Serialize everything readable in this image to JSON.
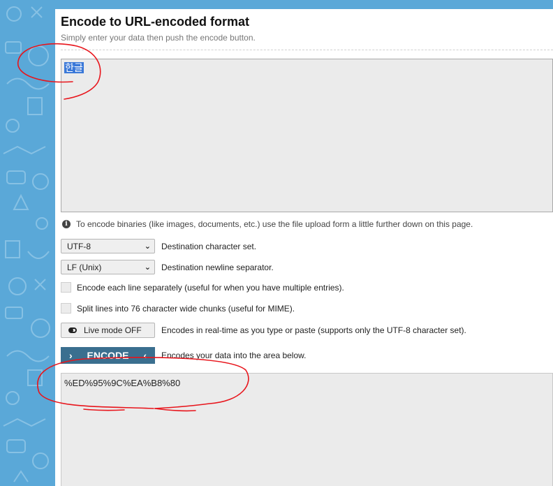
{
  "header": {
    "title": "Encode to URL-encoded format",
    "subtitle": "Simply enter your data then push the encode button."
  },
  "input": {
    "value": "한글"
  },
  "note": {
    "text": "To encode binaries (like images, documents, etc.) use the file upload form a little further down on this page."
  },
  "options": {
    "charset": {
      "value": "UTF-8",
      "label": "Destination character set."
    },
    "newline": {
      "value": "LF (Unix)",
      "label": "Destination newline separator."
    },
    "each_line": {
      "label": "Encode each line separately (useful for when you have multiple entries)."
    },
    "split_lines": {
      "label": "Split lines into 76 character wide chunks (useful for MIME)."
    },
    "live_mode": {
      "button": "Live mode OFF",
      "label": "Encodes in real-time as you type or paste (supports only the UTF-8 character set)."
    },
    "encode": {
      "button": "ENCODE",
      "label": "Encodes your data into the area below."
    }
  },
  "output": {
    "value": "%ED%95%9C%EA%B8%80"
  },
  "colors": {
    "background_pattern": "#5aa8d8",
    "encode_button": "#3a6f8f",
    "selection": "#3a78d8",
    "annotation": "#e8141b"
  }
}
